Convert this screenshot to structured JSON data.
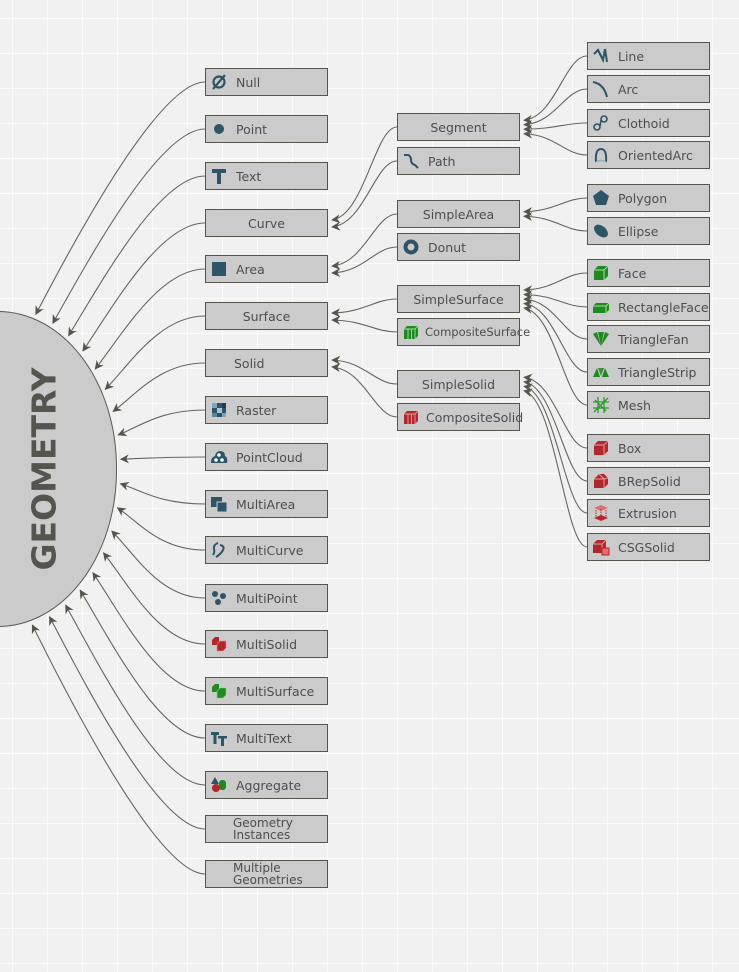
{
  "title": "GEOMETRY",
  "colors": {
    "background": "#f1f1f1",
    "node_fill": "#cbcbcb",
    "node_border": "#55554d",
    "text": "#4e4e4e",
    "icon_blue": "#2e5468",
    "icon_green": "#1f8a1f",
    "icon_red": "#b3262c",
    "link": "#666660"
  },
  "level1": [
    {
      "id": "null",
      "label": "Null",
      "icon": "null-set-icon"
    },
    {
      "id": "point",
      "label": "Point",
      "icon": "dot-icon"
    },
    {
      "id": "text",
      "label": "Text",
      "icon": "text-t-icon"
    },
    {
      "id": "curve",
      "label": "Curve",
      "icon": ""
    },
    {
      "id": "area",
      "label": "Area",
      "icon": "filled-square-icon"
    },
    {
      "id": "surface",
      "label": "Surface",
      "icon": ""
    },
    {
      "id": "solid",
      "label": "Solid",
      "icon": ""
    },
    {
      "id": "raster",
      "label": "Raster",
      "icon": "raster-grid-icon"
    },
    {
      "id": "pointcloud",
      "label": "PointCloud",
      "icon": "point-cloud-icon"
    },
    {
      "id": "multiarea",
      "label": "MultiArea",
      "icon": "multi-area-icon"
    },
    {
      "id": "multicurve",
      "label": "MultiCurve",
      "icon": "multi-curve-icon"
    },
    {
      "id": "multipoint",
      "label": "MultiPoint",
      "icon": "multi-point-icon"
    },
    {
      "id": "multisolid",
      "label": "MultiSolid",
      "icon": "multi-solid-icon"
    },
    {
      "id": "multisurface",
      "label": "MultiSurface",
      "icon": "multi-surface-icon"
    },
    {
      "id": "multitext",
      "label": "MultiText",
      "icon": "multi-text-icon"
    },
    {
      "id": "aggregate",
      "label": "Aggregate",
      "icon": "aggregate-shapes-icon"
    },
    {
      "id": "geometryinstances",
      "label": "Geometry Instances",
      "icon": ""
    },
    {
      "id": "multiplegeometries",
      "label": "Multiple Geometries",
      "icon": ""
    }
  ],
  "level2": [
    {
      "id": "segment",
      "label": "Segment",
      "icon": "",
      "parent": "curve"
    },
    {
      "id": "path",
      "label": "Path",
      "icon": "path-squiggle-icon",
      "parent": "curve"
    },
    {
      "id": "simplearea",
      "label": "SimpleArea",
      "icon": "",
      "parent": "area"
    },
    {
      "id": "donut",
      "label": "Donut",
      "icon": "donut-ring-icon",
      "parent": "area"
    },
    {
      "id": "simplesurface",
      "label": "SimpleSurface",
      "icon": "",
      "parent": "surface"
    },
    {
      "id": "compositesurface",
      "label": "CompositeSurface",
      "icon": "composite-surface-icon",
      "parent": "surface"
    },
    {
      "id": "simplesolid",
      "label": "SimpleSolid",
      "icon": "",
      "parent": "solid"
    },
    {
      "id": "compositesolid",
      "label": "CompositeSolid",
      "icon": "composite-solid-icon",
      "parent": "solid"
    }
  ],
  "level3": [
    {
      "id": "line",
      "label": "Line",
      "icon": "polyline-icon",
      "parent": "segment"
    },
    {
      "id": "arc",
      "label": "Arc",
      "icon": "arc-icon",
      "parent": "segment"
    },
    {
      "id": "clothoid",
      "label": "Clothoid",
      "icon": "clothoid-spiral-icon",
      "parent": "segment"
    },
    {
      "id": "orientedarc",
      "label": "OrientedArc",
      "icon": "oriented-arc-icon",
      "parent": "segment"
    },
    {
      "id": "polygon",
      "label": "Polygon",
      "icon": "pentagon-icon",
      "parent": "simplearea"
    },
    {
      "id": "ellipse",
      "label": "Ellipse",
      "icon": "ellipse-icon",
      "parent": "simplearea"
    },
    {
      "id": "face",
      "label": "Face",
      "icon": "face-cube-icon",
      "parent": "simplesurface"
    },
    {
      "id": "rectangleface",
      "label": "RectangleFace",
      "icon": "rectangle-face-icon",
      "parent": "simplesurface"
    },
    {
      "id": "trianglefan",
      "label": "TriangleFan",
      "icon": "triangle-fan-icon",
      "parent": "simplesurface"
    },
    {
      "id": "trianglestrip",
      "label": "TriangleStrip",
      "icon": "triangle-strip-icon",
      "parent": "simplesurface"
    },
    {
      "id": "mesh",
      "label": "Mesh",
      "icon": "mesh-grid-icon",
      "parent": "simplesurface"
    },
    {
      "id": "box",
      "label": "Box",
      "icon": "box-cube-icon",
      "parent": "simplesolid"
    },
    {
      "id": "brepsolid",
      "label": "BRepSolid",
      "icon": "brep-solid-icon",
      "parent": "simplesolid"
    },
    {
      "id": "extrusion",
      "label": "Extrusion",
      "icon": "extrusion-icon",
      "parent": "simplesolid"
    },
    {
      "id": "csgsolid",
      "label": "CSGSolid",
      "icon": "csg-solid-icon",
      "parent": "simplesolid"
    }
  ]
}
